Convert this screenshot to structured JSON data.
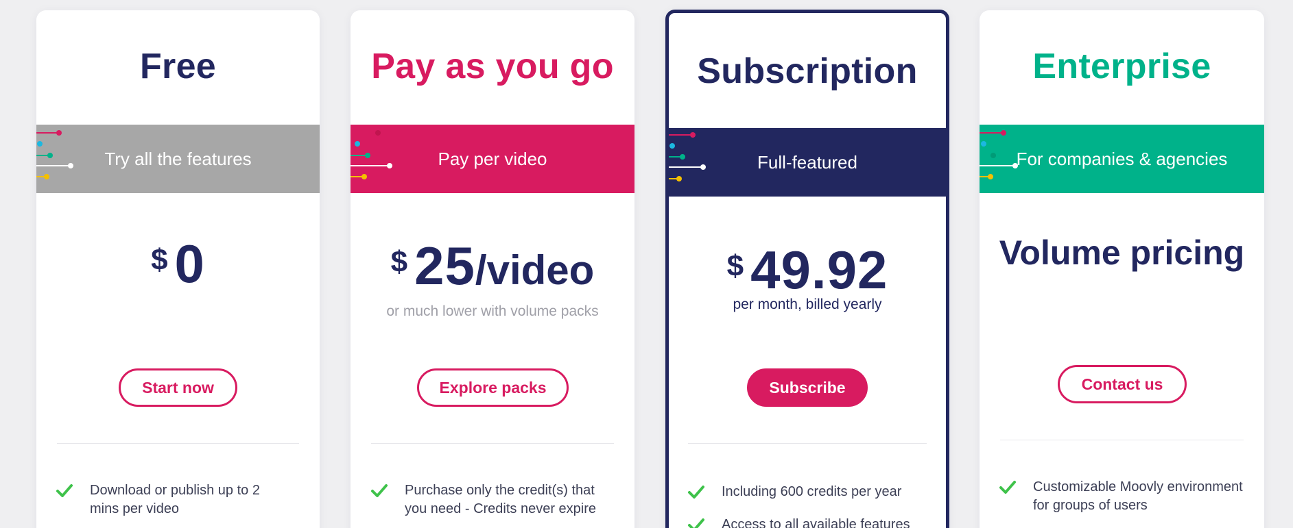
{
  "colors": {
    "navy": "#22275f",
    "pink": "#d81b60",
    "teal": "#00b28a",
    "gray_band": "#a7a7a7",
    "check_green": "#3ec24a",
    "muted": "#a0a0a8"
  },
  "plans": [
    {
      "title": "Free",
      "band_text": "Try all the features",
      "currency": "$",
      "amount": "0",
      "button_label": "Start now",
      "features": [
        "Download or publish up to 2 mins per video"
      ]
    },
    {
      "title": "Pay as you go",
      "band_text": "Pay per video",
      "currency": "$",
      "amount": "25",
      "unit": "/video",
      "price_note": "or much lower with volume packs",
      "button_label": "Explore packs",
      "features": [
        "Purchase only the credit(s) that you need - Credits never expire"
      ]
    },
    {
      "title": "Subscription",
      "band_text": "Full-featured",
      "currency": "$",
      "amount": "49.92",
      "price_note": "per month, billed yearly",
      "button_label": "Subscribe",
      "features": [
        "Including 600 credits per year",
        "Access to all available features"
      ]
    },
    {
      "title": "Enterprise",
      "band_text": "For companies & agencies",
      "price_label": "Volume pricing",
      "button_label": "Contact us",
      "features": [
        "Customizable Moovly environment for groups of users"
      ]
    }
  ]
}
